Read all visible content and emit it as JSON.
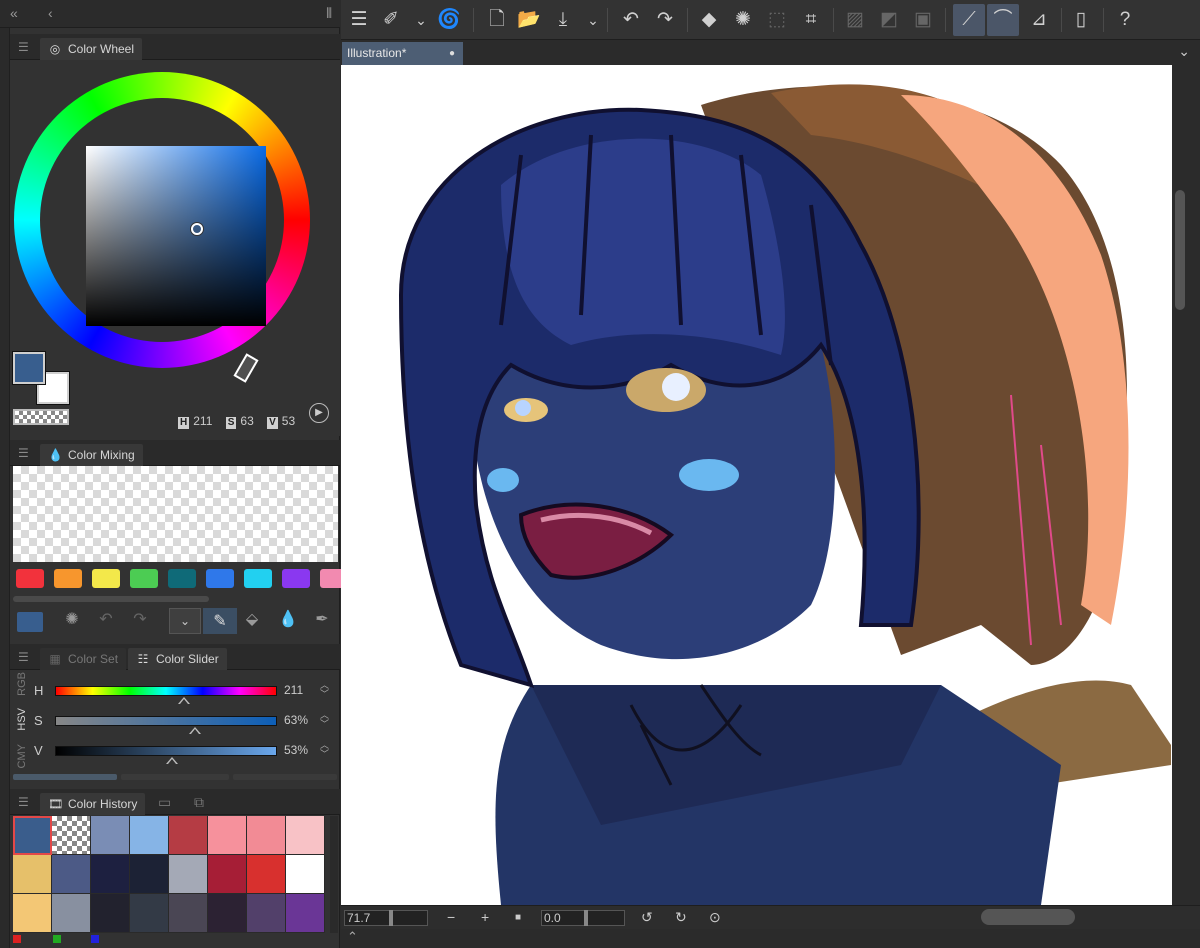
{
  "toolbar": {
    "icons": [
      "menu-icon",
      "brush-settings-icon",
      "chevron-down-icon",
      "spiral-icon",
      "new-file-icon",
      "open-folder-icon",
      "save-icon",
      "chevron-down-icon",
      "undo-icon",
      "redo-icon",
      "fill-icon",
      "loading-icon",
      "select-all-icon",
      "transform-icon",
      "clear-selection-icon",
      "invert-selection-icon",
      "crop-icon",
      "snap-ruler-icon",
      "snap-special-ruler-icon",
      "snap-grid-icon",
      "smartphone-icon",
      "help-icon"
    ]
  },
  "document": {
    "tab_label": "Illustration*",
    "modified_dot": "●"
  },
  "color_wheel": {
    "tab_label": "Color Wheel",
    "main_color": "#385e8e",
    "sub_color": "#ffffff",
    "h_key": "H",
    "h_value": "211",
    "s_key": "S",
    "s_value": "63",
    "v_key": "V",
    "v_value": "53"
  },
  "color_mixing": {
    "tab_label": "Color Mixing",
    "palette": [
      "#f2323c",
      "#f7962d",
      "#f3e84a",
      "#4ccc53",
      "#0f6a78",
      "#2f78ea",
      "#22d0f0",
      "#8a38f0",
      "#f28ab0"
    ]
  },
  "color_slider": {
    "tabs": [
      "Color Set",
      "Color Slider"
    ],
    "modes": [
      "RGB",
      "HSV",
      "CMY"
    ],
    "active_mode": "HSV",
    "rows": [
      {
        "label": "H",
        "value": "211"
      },
      {
        "label": "S",
        "value": "63%"
      },
      {
        "label": "V",
        "value": "53%"
      }
    ]
  },
  "color_history": {
    "tab_label": "Color History",
    "colors": [
      "#3a5d8c",
      "checker",
      "#7a8db5",
      "#86b4e6",
      "#b53c44",
      "#f6919c",
      "#f28b95",
      "#f8c2c6",
      "#e6c06a",
      "#4c5a86",
      "#1d2040",
      "#1c2235",
      "#a4a9b6",
      "#a61e36",
      "#d8302e",
      "#ffffff",
      "#f3c775",
      "#8890a0",
      "#22222e",
      "#333a46",
      "#4a4654",
      "#2c2233",
      "#52406a",
      "#6a3696"
    ]
  },
  "canvas_bar": {
    "zoom": "71.7",
    "zoom_out": "−",
    "zoom_in": "+",
    "fit": "■",
    "rotation": "0.0",
    "expand": "⌃"
  }
}
